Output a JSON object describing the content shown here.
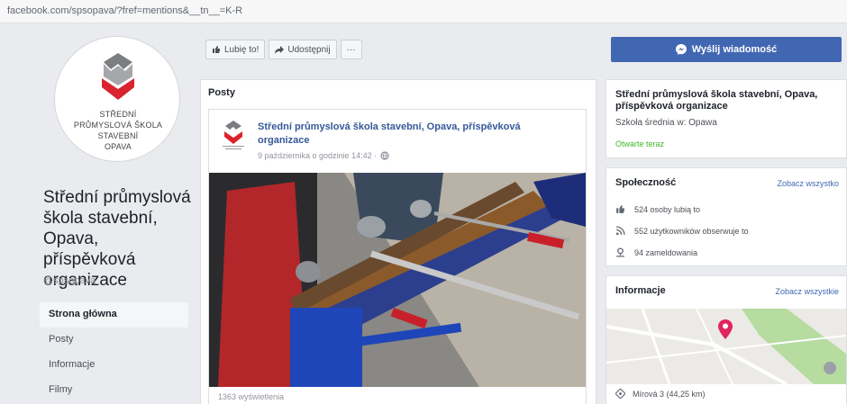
{
  "browser": {
    "url": "facebook.com/spsopava/?fref=mentions&__tn__=K-R"
  },
  "page": {
    "logo_text": [
      "STŘEDNÍ",
      "PRŮMYSLOVÁ ŠKOLA",
      "STAVEBNÍ",
      "OPAVA"
    ],
    "name": "Střední průmyslová škola stavební, Opava, příspěvková organizace",
    "handle": "@spsopava"
  },
  "nav": {
    "items": [
      {
        "label": "Strona główna",
        "active": true
      },
      {
        "label": "Posty"
      },
      {
        "label": "Informacje"
      },
      {
        "label": "Filmy"
      }
    ]
  },
  "actions": {
    "like": "Lubię to!",
    "share": "Udostępnij",
    "more": "···"
  },
  "posts": {
    "title": "Posty",
    "post": {
      "author": "Střední průmyslová škola stavební, Opava, příspěvková organizace",
      "time": "9 października o godzinie 14:42 · ",
      "views": "1363 wyświetlenia"
    }
  },
  "sidebar": {
    "send_button": "Wyślij wiadomość",
    "about": {
      "name": "Střední průmyslová škola stavební, Opava, příspěvková organizace",
      "category": "Szkoła średnia w: Opawa",
      "open": "Otwarte teraz"
    },
    "community": {
      "title": "Społeczność",
      "see_all": "Zobacz wszystko",
      "likes": "524 osoby lubią to",
      "followers": "552 użytkowników obserwuje to",
      "checkins": "94 zameldowania"
    },
    "info": {
      "title": "Informacje",
      "see_all": "Zobacz wszystkie",
      "address": "Mírová 3 (44,25 km)"
    }
  },
  "colors": {
    "brand": "#4267b2",
    "logo_red": "#d9232e",
    "logo_gray": "#7b7d80"
  }
}
